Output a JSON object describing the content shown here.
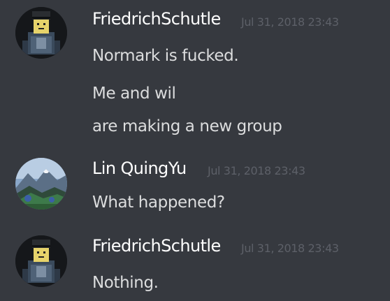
{
  "messages": [
    {
      "author": "FriedrichSchutle",
      "timestamp": "Jul 31, 2018 23:43",
      "avatar_icon": "roblox-character-avatar",
      "lines": [
        "Normark is fucked.",
        "Me and wil",
        "are making a new group"
      ]
    },
    {
      "author": "Lin QuingYu",
      "timestamp": "Jul 31, 2018 23:43",
      "avatar_icon": "mountain-landscape-avatar",
      "lines": [
        "What happened?"
      ]
    },
    {
      "author": "FriedrichSchutle",
      "timestamp": "Jul 31, 2018 23:43",
      "avatar_icon": "roblox-character-avatar",
      "lines": [
        "Nothing."
      ]
    }
  ],
  "colors": {
    "background": "#36393f",
    "username": "#ffffff",
    "message_text": "#dcddde",
    "timestamp": "#5d6068"
  }
}
